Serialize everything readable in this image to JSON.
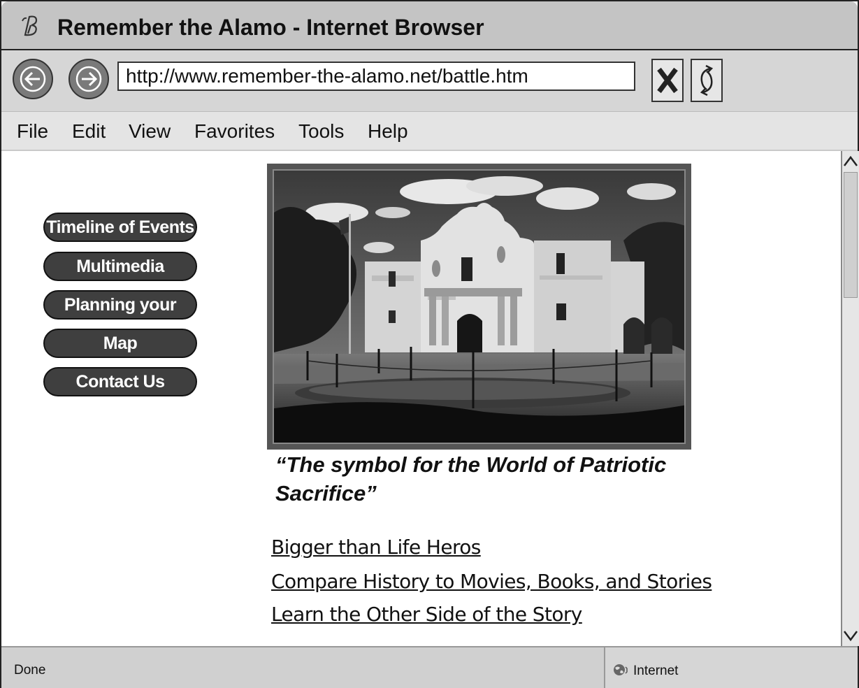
{
  "window": {
    "title": "Remember the Alamo - Internet Browser",
    "title_icon": "browser-logo-icon"
  },
  "navbar": {
    "back_icon": "back-arrow-icon",
    "forward_icon": "forward-arrow-icon",
    "address": "http://www.remember-the-alamo.net/battle.htm",
    "stop_icon": "stop-x-icon",
    "refresh_icon": "refresh-icon"
  },
  "menu": {
    "items": [
      "File",
      "Edit",
      "View",
      "Favorites",
      "Tools",
      "Help"
    ]
  },
  "sidebar": {
    "items": [
      {
        "label": "Timeline of Events"
      },
      {
        "label": "Multimedia"
      },
      {
        "label": "Planning your Tour"
      },
      {
        "label": "Map"
      },
      {
        "label": "Contact Us"
      }
    ]
  },
  "main": {
    "photo_subject": "alamo-mission-photo",
    "quote_line1": "“The symbol for the World of Patriotic",
    "quote_line2": "Sacrifice”",
    "links": [
      {
        "label": "Bigger than Life Heros"
      },
      {
        "label": "Compare History to Movies, Books, and Stories"
      },
      {
        "label": "Learn the Other Side of the Story"
      }
    ]
  },
  "status": {
    "left": "Done",
    "zone": "Internet",
    "zone_icon": "globe-icon"
  },
  "colors": {
    "titlebar": "#c4c4c4",
    "button_fill": "#3f3f3f",
    "nav_button": "#7a7a7a"
  }
}
